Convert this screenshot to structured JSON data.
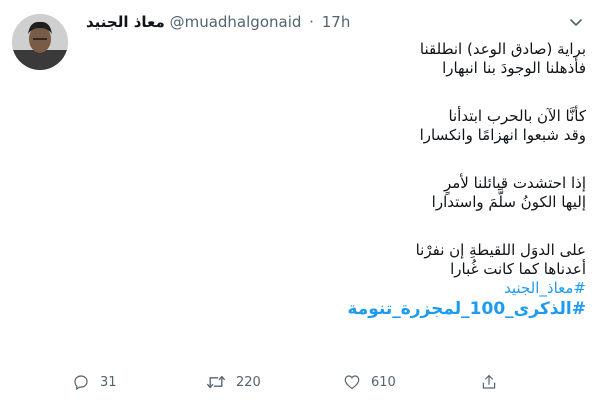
{
  "tweet": {
    "display_name": "معاذ الجنيد",
    "handle": "@muadhalgonaid",
    "separator": "·",
    "time": "17h",
    "stanzas": [
      [
        "براية (صادق الوعد) انطلقنا",
        "فأذهلنا الوجودَ بنا انبهارا"
      ],
      [
        "كأنَّا الآن بالحرب ابتدأنا",
        "وقد شبعوا انهزامًا وانكسارا"
      ],
      [
        "إذا احتشدت قبائلنا لأمرٍ",
        "إليها الكونُ سلَّمَ واستدارا"
      ],
      [
        "على الدوَل اللقيطةِ إن نفرْنا",
        "أعدناها كما كانت غُبارا"
      ]
    ],
    "hashtags": [
      "#معاذ_الجنيد",
      "#الذكرى_100_لمجزرة_تنومة"
    ]
  },
  "actions": {
    "reply_count": "31",
    "retweet_count": "220",
    "like_count": "610"
  },
  "icons": {
    "reply": "reply-icon",
    "retweet": "retweet-icon",
    "like": "heart-icon",
    "share": "share-icon",
    "menu": "chevron-down-icon"
  },
  "colors": {
    "link": "#1d9bf0",
    "secondary_text": "#536471",
    "text": "#0f1419"
  }
}
